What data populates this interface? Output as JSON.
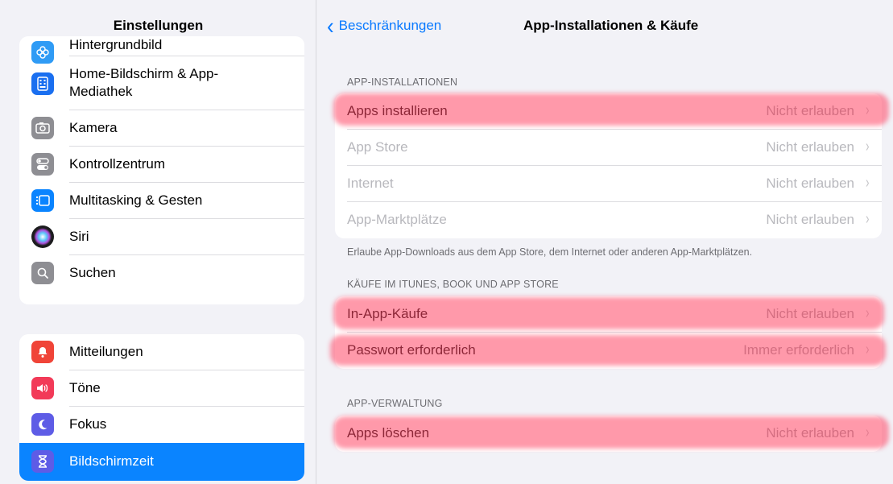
{
  "sidebar": {
    "title": "Einstellungen",
    "group1": [
      {
        "label": "Hintergrundbild",
        "icon": "wallpaper-flower-icon",
        "color": "#2f9bf5"
      },
      {
        "label": "Home-Bildschirm & App-\nMediathek",
        "icon": "home-screen-icon",
        "color": "#1a6ff0"
      },
      {
        "label": "Kamera",
        "icon": "camera-icon",
        "color": "#8e8e93"
      },
      {
        "label": "Kontrollzentrum",
        "icon": "toggles-icon",
        "color": "#8e8e93"
      },
      {
        "label": "Multitasking & Gesten",
        "icon": "multitasking-icon",
        "color": "#0a84ff"
      },
      {
        "label": "Siri",
        "icon": "siri-icon",
        "color": "#1c1c1e"
      },
      {
        "label": "Suchen",
        "icon": "search-icon",
        "color": "#8e8e93"
      }
    ],
    "group2": [
      {
        "label": "Mitteilungen",
        "icon": "notifications-bell-icon",
        "color": "#f04438"
      },
      {
        "label": "Töne",
        "icon": "speaker-sound-icon",
        "color": "#f23a58"
      },
      {
        "label": "Fokus",
        "icon": "moon-icon",
        "color": "#5e5ce6"
      },
      {
        "label": "Bildschirmzeit",
        "icon": "hourglass-icon",
        "color": "#5e5ce6",
        "selected": true
      }
    ]
  },
  "nav": {
    "back_label": "Beschränkungen",
    "title": "App-Installationen & Käufe"
  },
  "sections": {
    "installs_header": "APP-INSTALLATIONEN",
    "installs_rows": [
      {
        "label": "Apps installieren",
        "value": "Nicht erlauben"
      },
      {
        "label": "App Store",
        "value": "Nicht erlauben"
      },
      {
        "label": "Internet",
        "value": "Nicht erlauben"
      },
      {
        "label": "App-Marktplätze",
        "value": "Nicht erlauben"
      }
    ],
    "installs_footer": "Erlaube App-Downloads aus dem App Store, dem Internet oder anderen App-Marktplätzen.",
    "purchases_header": "KÄUFE IM ITUNES, BOOK UND APP STORE",
    "purchases_rows": [
      {
        "label": "In-App-Käufe",
        "value": "Nicht erlauben"
      },
      {
        "label": "Passwort erforderlich",
        "value": "Immer erforderlich"
      }
    ],
    "management_header": "APP-VERWALTUNG",
    "management_rows": [
      {
        "label": "Apps löschen",
        "value": "Nicht erlauben"
      }
    ]
  },
  "colors": {
    "accent": "#0a7aff",
    "selected_row": "#0a84ff",
    "highlight": "#ff4664"
  }
}
